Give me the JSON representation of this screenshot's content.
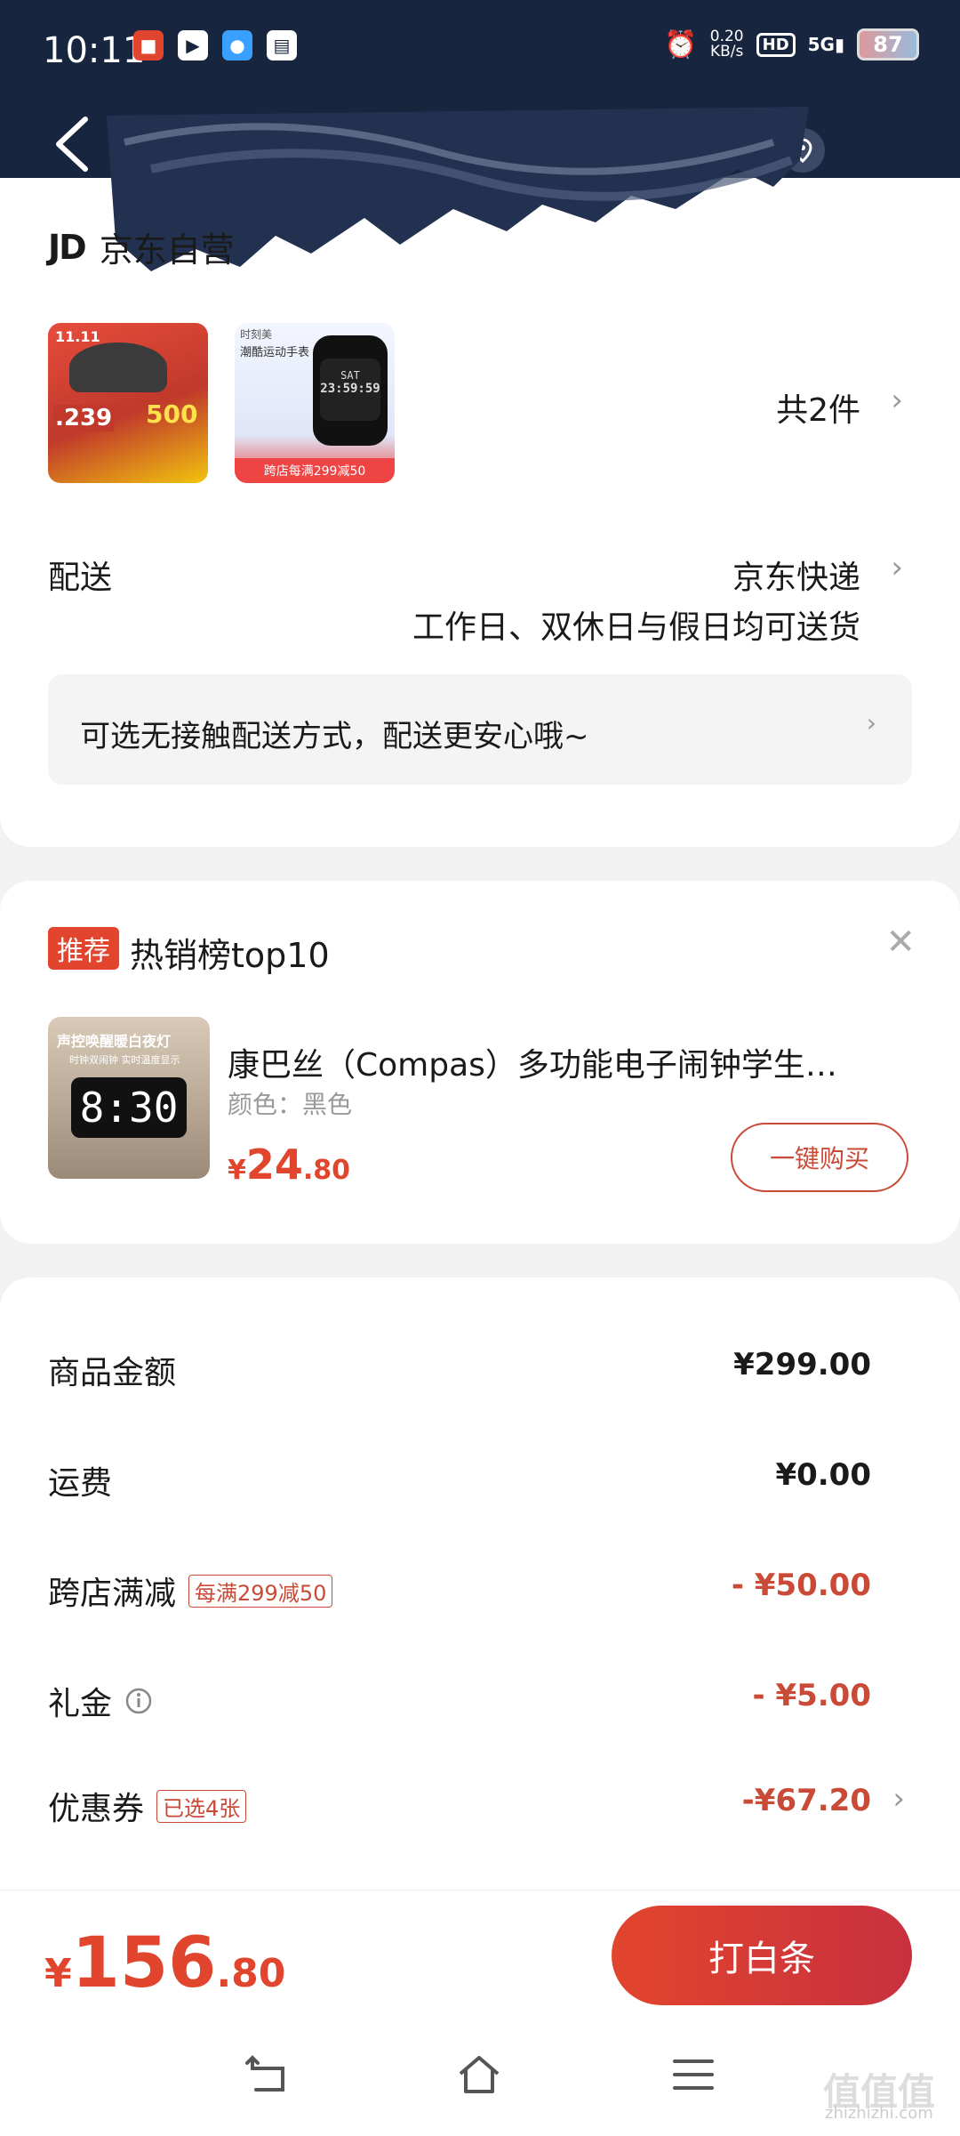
{
  "status_bar": {
    "time": "10:11",
    "net_speed_value": "0.20",
    "net_speed_unit": "KB/s",
    "hd": "HD",
    "signal": "5G",
    "battery": "87"
  },
  "header": {
    "back_icon": "chevron-left-icon",
    "location_icon": "location-pin-icon",
    "accent": "#17253f"
  },
  "order": {
    "store_logo": "JD",
    "store_name": "京东自营",
    "thumb1_badge": "11.11",
    "thumb1_price": ".239",
    "thumb1_promo": "500",
    "thumb2_brand": "时刻美",
    "thumb2_title": "潮酷运动手表",
    "thumb2_display_top": "SAT",
    "thumb2_display_time": "23:59:59",
    "thumb2_promo": "跨店每满299减50",
    "item_count": "共2件",
    "delivery_label": "配送",
    "delivery_method": "京东快递",
    "delivery_schedule": "工作日、双休日与假日均可送货",
    "contactless_note": "可选无接触配送方式，配送更安心哦~"
  },
  "recommend": {
    "badge": "推荐",
    "title": "热销榜top10",
    "close_icon": "close-icon",
    "image_caption": "声控唤醒暖白夜灯",
    "image_sub": "时钟双闹钟 实时温度显示",
    "clock_text": "8:30",
    "product_name": "康巴丝（Compas）多功能电子闹钟学生…",
    "spec": "颜色：黑色",
    "price_symbol": "¥",
    "price_int": "24",
    "price_dec": ".80",
    "buy_label": "一键购买"
  },
  "summary": {
    "rows": [
      {
        "label": "商品金额",
        "value": "¥299.00"
      },
      {
        "label": "运费",
        "value": "¥0.00"
      },
      {
        "label": "跨店满减",
        "tag": "每满299减50",
        "value": "- ¥50.00"
      },
      {
        "label": "礼金",
        "value": "- ¥5.00"
      },
      {
        "label": "优惠券",
        "tag": "已选4张",
        "value": "-¥67.20"
      }
    ]
  },
  "footer": {
    "total_symbol": "¥",
    "total_int": "156",
    "total_dec": ".80",
    "pay_label": "打白条",
    "watermark": "值值值",
    "watermark_url": "zhizhizhi.com"
  },
  "colors": {
    "accent_red": "#e2452d",
    "header_navy": "#17253f"
  }
}
